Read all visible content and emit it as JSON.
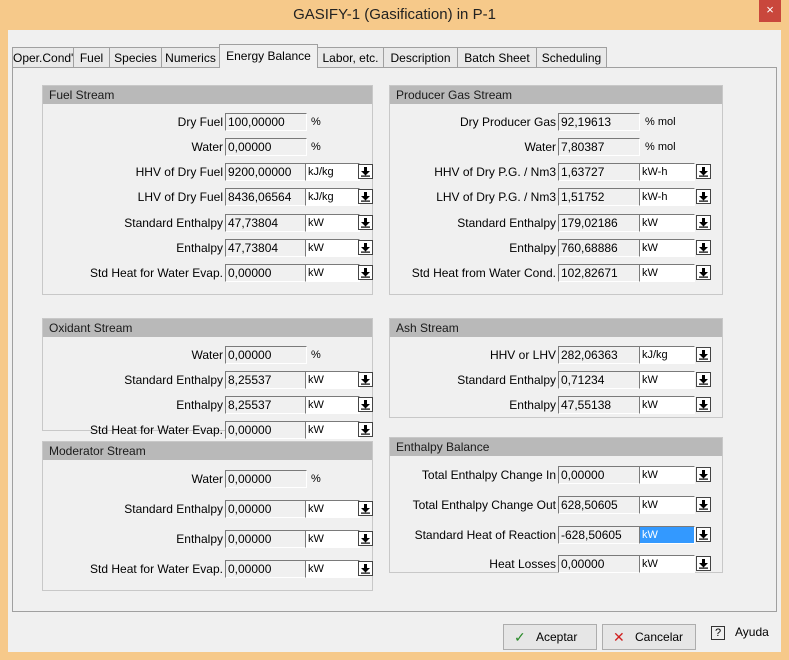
{
  "window": {
    "title": "GASIFY-1 (Gasification) in P-1",
    "close_symbol": "×"
  },
  "tabs": [
    "Oper.Cond's",
    "Fuel",
    "Species",
    "Numerics",
    "Energy Balance",
    "Labor, etc.",
    "Description",
    "Batch Sheet",
    "Scheduling"
  ],
  "active_tab": "Energy Balance",
  "fuel_stream": {
    "title": "Fuel Stream",
    "rows": [
      {
        "label": "Dry Fuel",
        "value": "100,00000",
        "unit": "%"
      },
      {
        "label": "Water",
        "value": "0,00000",
        "unit": "%"
      },
      {
        "label": "HHV of Dry Fuel",
        "value": "9200,00000",
        "unit": "kJ/kg"
      },
      {
        "label": "LHV of Dry Fuel",
        "value": "8436,06564",
        "unit": "kJ/kg"
      },
      {
        "label": "Standard Enthalpy",
        "value": "47,73804",
        "unit": "kW"
      },
      {
        "label": "Enthalpy",
        "value": "47,73804",
        "unit": "kW"
      },
      {
        "label": "Std Heat for Water Evap.",
        "value": "0,00000",
        "unit": "kW"
      }
    ]
  },
  "oxidant_stream": {
    "title": "Oxidant Stream",
    "rows": [
      {
        "label": "Water",
        "value": "0,00000",
        "unit": "%"
      },
      {
        "label": "Standard Enthalpy",
        "value": "8,25537",
        "unit": "kW"
      },
      {
        "label": "Enthalpy",
        "value": "8,25537",
        "unit": "kW"
      },
      {
        "label": "Std Heat for Water Evap.",
        "value": "0,00000",
        "unit": "kW"
      }
    ]
  },
  "moderator_stream": {
    "title": "Moderator Stream",
    "rows": [
      {
        "label": "Water",
        "value": "0,00000",
        "unit": "%"
      },
      {
        "label": "Standard Enthalpy",
        "value": "0,00000",
        "unit": "kW"
      },
      {
        "label": "Enthalpy",
        "value": "0,00000",
        "unit": "kW"
      },
      {
        "label": "Std Heat for Water Evap.",
        "value": "0,00000",
        "unit": "kW"
      }
    ]
  },
  "producer_gas_stream": {
    "title": "Producer Gas Stream",
    "rows": [
      {
        "label": "Dry Producer Gas",
        "value": "92,19613",
        "unit": "% mol"
      },
      {
        "label": "Water",
        "value": "7,80387",
        "unit": "% mol"
      },
      {
        "label": "HHV of Dry P.G. / Nm3",
        "value": "1,63727",
        "unit": "kW-h"
      },
      {
        "label": "LHV of Dry P.G. / Nm3",
        "value": "1,51752",
        "unit": "kW-h"
      },
      {
        "label": "Standard Enthalpy",
        "value": "179,02186",
        "unit": "kW"
      },
      {
        "label": "Enthalpy",
        "value": "760,68886",
        "unit": "kW"
      },
      {
        "label": "Std Heat from Water Cond.",
        "value": "102,82671",
        "unit": "kW"
      }
    ]
  },
  "ash_stream": {
    "title": "Ash Stream",
    "rows": [
      {
        "label": "HHV or LHV",
        "value": "282,06363",
        "unit": "kJ/kg"
      },
      {
        "label": "Standard Enthalpy",
        "value": "0,71234",
        "unit": "kW"
      },
      {
        "label": "Enthalpy",
        "value": "47,55138",
        "unit": "kW"
      }
    ]
  },
  "enthalpy_balance": {
    "title": "Enthalpy Balance",
    "rows": [
      {
        "label": "Total Enthalpy Change In",
        "value": "0,00000",
        "unit": "kW"
      },
      {
        "label": "Total Enthalpy Change Out",
        "value": "628,50605",
        "unit": "kW"
      },
      {
        "label": "Standard Heat of Reaction",
        "value": "-628,50605",
        "unit": "kW"
      },
      {
        "label": "Heat Losses",
        "value": "0,00000",
        "unit": "kW"
      }
    ]
  },
  "buttons": {
    "accept": "Aceptar",
    "cancel": "Cancelar",
    "help": "Ayuda",
    "accept_icon": "✓",
    "cancel_icon": "✕",
    "help_icon": "?"
  },
  "colors": {
    "frame": "#f6c98a",
    "selected_unit": "#3399ff",
    "group_header": "#b9b9b9"
  }
}
